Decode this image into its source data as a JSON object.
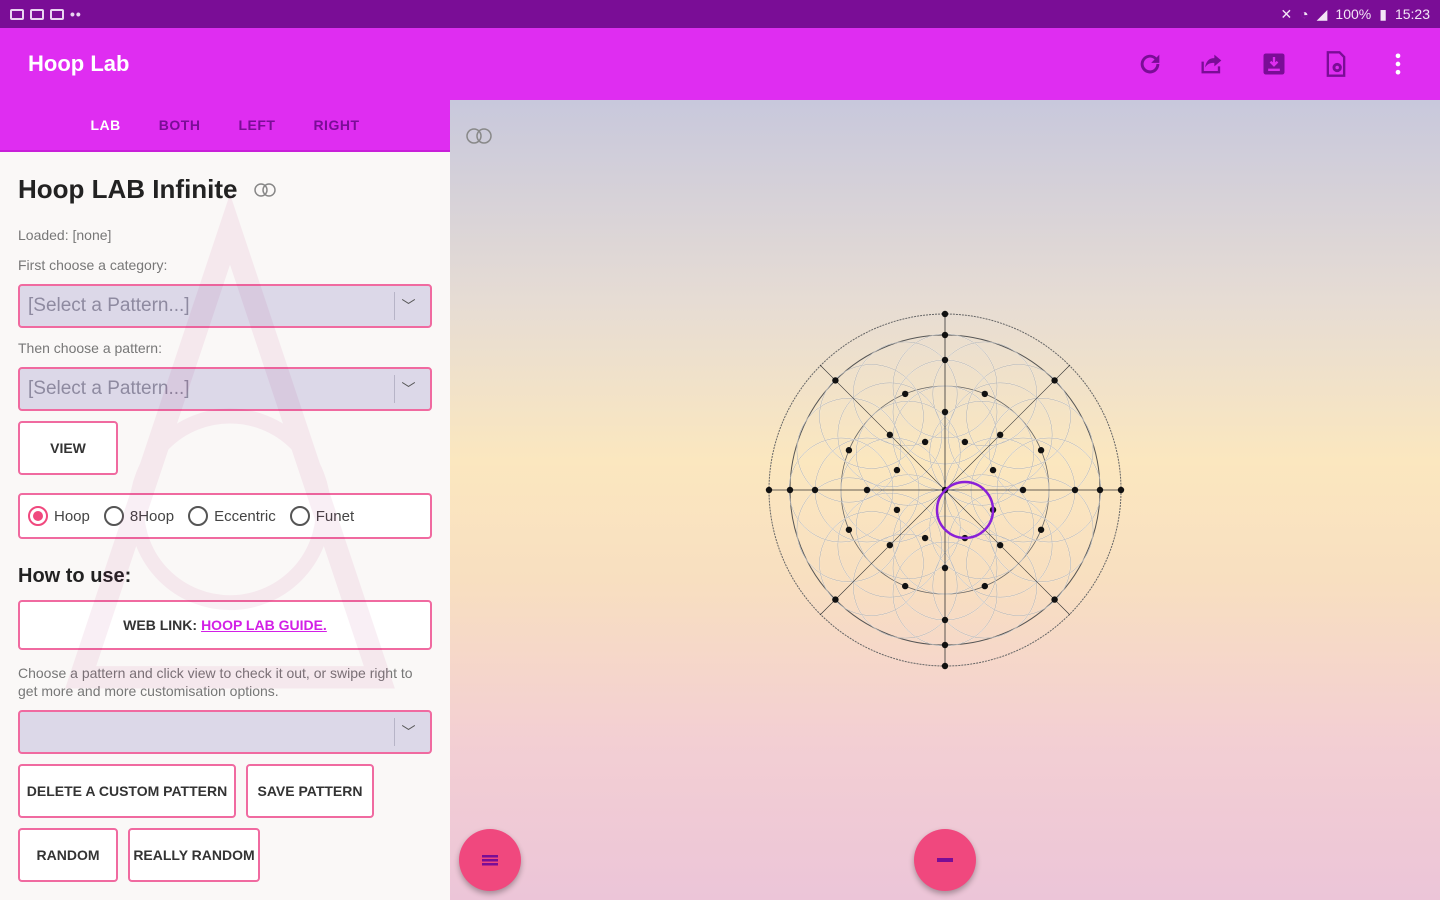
{
  "status": {
    "battery": "100%",
    "time": "15:23"
  },
  "app": {
    "title": "Hoop Lab",
    "actions": [
      "refresh-icon",
      "share-icon",
      "download-icon",
      "settings-file-icon",
      "more-vert-icon"
    ]
  },
  "tabs": [
    {
      "label": "LAB",
      "active": true
    },
    {
      "label": "BOTH",
      "active": false
    },
    {
      "label": "LEFT",
      "active": false
    },
    {
      "label": "RIGHT",
      "active": false
    }
  ],
  "panel": {
    "heading": "Hoop LAB Infinite",
    "loaded": "Loaded:  [none]",
    "category_label": "First choose a category:",
    "category_select": "[Select a Pattern...]",
    "pattern_label": "Then choose a pattern:",
    "pattern_select": "[Select a Pattern...]",
    "view_button": "VIEW",
    "radios": [
      {
        "label": "Hoop",
        "selected": true
      },
      {
        "label": "8Hoop",
        "selected": false
      },
      {
        "label": "Eccentric",
        "selected": false
      },
      {
        "label": "Funet",
        "selected": false
      }
    ],
    "how_to_use": "How to use:",
    "web_link_prefix": "WEB LINK:",
    "web_link_text": "HOOP LAB GUIDE.",
    "description": "Choose a pattern and click view to check it out, or swipe right to get more and more customisation options.",
    "custom_select": "",
    "delete_button": "DELETE A CUSTOM PATTERN",
    "save_button": "SAVE PATTERN",
    "random_button": "RANDOM",
    "really_random_button": "REALLY RANDOM"
  },
  "colors": {
    "status_bar": "#7a0d96",
    "app_bar": "#df2df1",
    "accent": "#f0487e",
    "link": "#d21fe6",
    "hoop_stroke": "#8a20d8"
  }
}
